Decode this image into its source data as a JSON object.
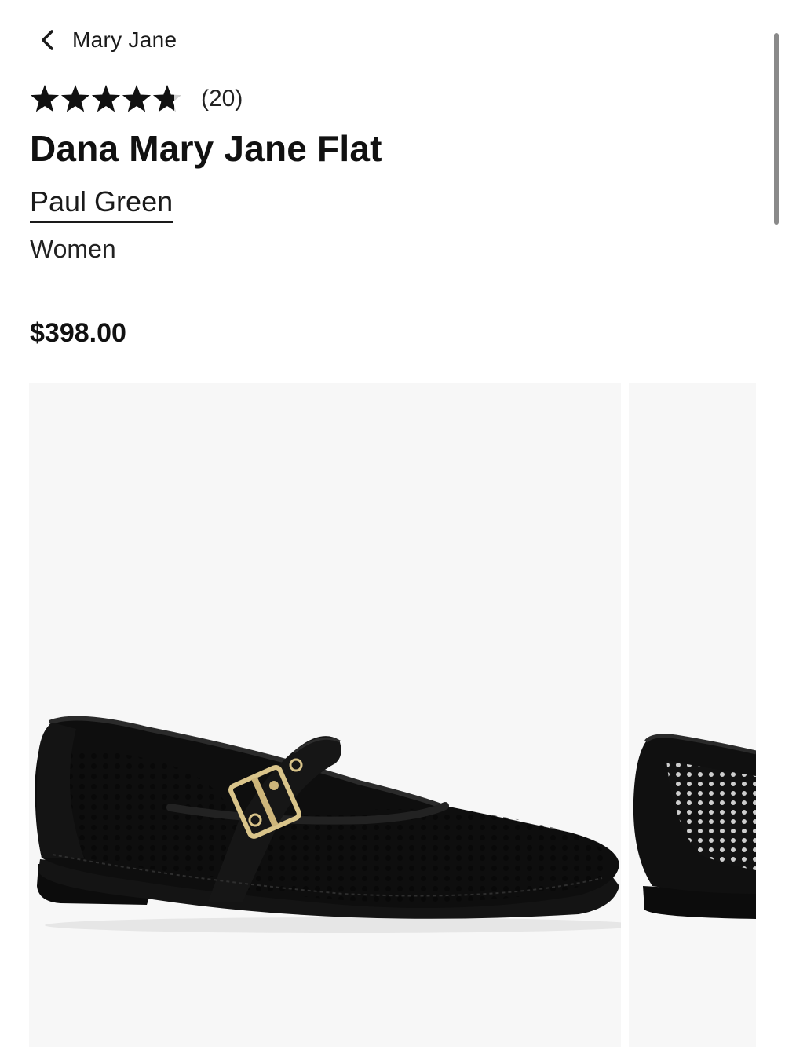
{
  "nav": {
    "back_label": "Mary Jane",
    "back_icon": "chevron-left-icon"
  },
  "product": {
    "rating": 4.7,
    "rating_max": 5,
    "review_count": "(20)",
    "title": "Dana Mary Jane Flat",
    "brand": "Paul Green",
    "gender": "Women",
    "price": "$398.00"
  },
  "gallery": {
    "images": [
      {
        "name": "black perforated mary jane flat side view"
      },
      {
        "name": "black perforated mary jane flat rear view"
      }
    ]
  },
  "colors": {
    "text": "#111111",
    "image_bg": "#f7f7f7",
    "scrollbar": "#8a8a8a"
  }
}
